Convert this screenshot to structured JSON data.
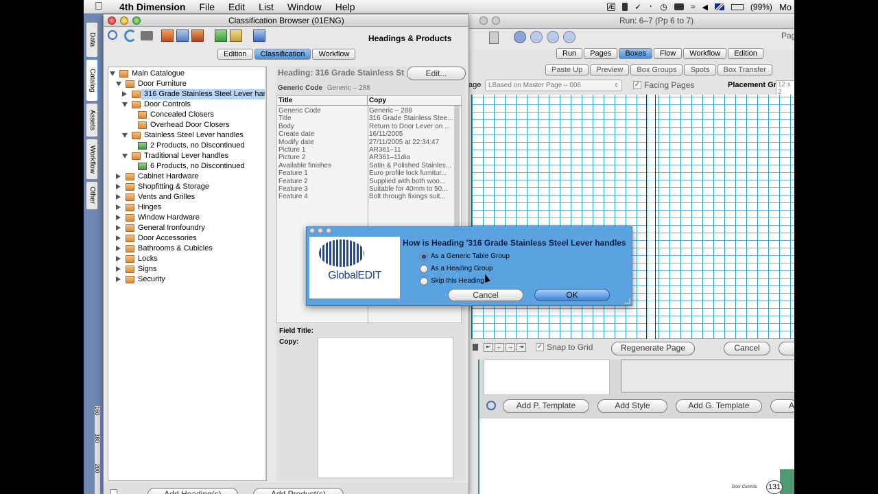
{
  "menubar": {
    "app_name": "4th Dimension",
    "menus": [
      "File",
      "Edit",
      "List",
      "Window",
      "Help"
    ],
    "battery": "(99%)",
    "user_trunc": "Mo"
  },
  "side_tabs": [
    "Data",
    "Catalog",
    "Assets",
    "Workflow",
    "Other"
  ],
  "ruler_marks": [
    "160",
    "180",
    "200"
  ],
  "classification": {
    "title": "Classification Browser (01ENG)",
    "header_label": "Headings & Products",
    "tabs": [
      "Edition",
      "Classification",
      "Workflow"
    ],
    "selected_tab": "Classification",
    "tree": [
      {
        "label": "Main Catalogue",
        "level": 0,
        "state": "open",
        "kind": "folder"
      },
      {
        "label": "Door Furniture",
        "level": 1,
        "state": "open",
        "kind": "folder"
      },
      {
        "label": "316 Grade Stainless Steel Lever han...",
        "level": 2,
        "state": "closed",
        "kind": "folder",
        "selected": true
      },
      {
        "label": "Door Controls",
        "level": 2,
        "state": "open",
        "kind": "folder"
      },
      {
        "label": "Concealed Closers",
        "level": 3,
        "state": "none",
        "kind": "folder"
      },
      {
        "label": "Overhead Door Closers",
        "level": 3,
        "state": "none",
        "kind": "folder"
      },
      {
        "label": "Stainless Steel Lever handles",
        "level": 2,
        "state": "open",
        "kind": "folder"
      },
      {
        "label": "2 Products, no Discontinued",
        "level": 3,
        "state": "none",
        "kind": "product"
      },
      {
        "label": "Traditional Lever handles",
        "level": 2,
        "state": "open",
        "kind": "folder"
      },
      {
        "label": "6 Products, no Discontinued",
        "level": 3,
        "state": "none",
        "kind": "product"
      },
      {
        "label": "Cabinet Hardware",
        "level": 1,
        "state": "closed",
        "kind": "folder"
      },
      {
        "label": "Shopfitting & Storage",
        "level": 1,
        "state": "closed",
        "kind": "folder"
      },
      {
        "label": "Vents and Grilles",
        "level": 1,
        "state": "closed",
        "kind": "folder"
      },
      {
        "label": "Hinges",
        "level": 1,
        "state": "closed",
        "kind": "folder"
      },
      {
        "label": "Window Hardware",
        "level": 1,
        "state": "closed",
        "kind": "folder"
      },
      {
        "label": "General Ironfoundry",
        "level": 1,
        "state": "closed",
        "kind": "folder"
      },
      {
        "label": "Door Accessories",
        "level": 1,
        "state": "closed",
        "kind": "folder"
      },
      {
        "label": "Bathrooms & Cubicles",
        "level": 1,
        "state": "closed",
        "kind": "folder"
      },
      {
        "label": "Locks",
        "level": 1,
        "state": "closed",
        "kind": "folder"
      },
      {
        "label": "Signs",
        "level": 1,
        "state": "closed",
        "kind": "folder"
      },
      {
        "label": "Security",
        "level": 1,
        "state": "closed",
        "kind": "folder"
      }
    ],
    "heading_title": "Heading: 316 Grade Stainless St",
    "edit_button": "Edit...",
    "generic_code_label": "Generic Code",
    "generic_code_value": "Generic – 288",
    "col_title": "Title",
    "col_copy": "Copy",
    "rows": [
      [
        "Generic Code",
        "Generic – 288"
      ],
      [
        "Title",
        "316 Grade Stainless Stee..."
      ],
      [
        "Body",
        "Return to Door Lever on ..."
      ],
      [
        "Create date",
        "16/11/2005"
      ],
      [
        "Modify date",
        "27/11/2005 at 22:34:47"
      ],
      [
        "Picture 1",
        "AR361–11"
      ],
      [
        "Picture 2",
        "AR361–11dia"
      ],
      [
        "Available finishes",
        "Satin & Polished Stainles..."
      ],
      [
        "Feature 1",
        "Euro profile lock furnitur..."
      ],
      [
        "Feature 2",
        "Supplied with both woo..."
      ],
      [
        "Feature 3",
        "Suitable for 40mm to 50..."
      ],
      [
        "Feature 4",
        "Bolt through fixings suit..."
      ]
    ],
    "field_title_label": "Field Title:",
    "copy_label": "Copy:",
    "add_heading": "Add Heading(s)",
    "add_product": "Add Product(s)"
  },
  "run_window": {
    "title": "Run: 6–7 (Pp 6 to 7)",
    "page_trunc": "Pag",
    "tabs": [
      "Run",
      "Pages",
      "Boxes",
      "Flow",
      "Workflow",
      "Edition"
    ],
    "selected_tab": "Boxes",
    "subtabs": [
      "Paste Up",
      "Preview",
      "Box Groups",
      "Spots",
      "Box Transfer"
    ],
    "page_label": "age",
    "master_select": "LBased on Master Page – 006",
    "facing_pages": "Facing Pages",
    "placement_label": "Placement Gri",
    "placement_value": "12 x 2",
    "snap_to_grid": "Snap to Grid",
    "regenerate": "Regenerate Page",
    "cancel": "Cancel",
    "add_p_template": "Add P. Template",
    "add_style": "Add Style",
    "add_g_template": "Add G. Template",
    "add_trunc": "A"
  },
  "dialog": {
    "question": "How is Heading '316 Grade Stainless Steel Lever handles",
    "options": [
      "As a Generic Table Group",
      "As a Heading Group",
      "Skip this Heading"
    ],
    "selected": 0,
    "logo_text": "GlobalEDIT",
    "cancel": "Cancel",
    "ok": "OK"
  },
  "footer": {
    "label": "Door Controls",
    "page_number": "131"
  },
  "colors": {
    "dialog_bg": "#5aa3e0",
    "grid_line": "#3aa0b8",
    "selection": "#b8d4f5",
    "accent": "#4b8fd8"
  }
}
